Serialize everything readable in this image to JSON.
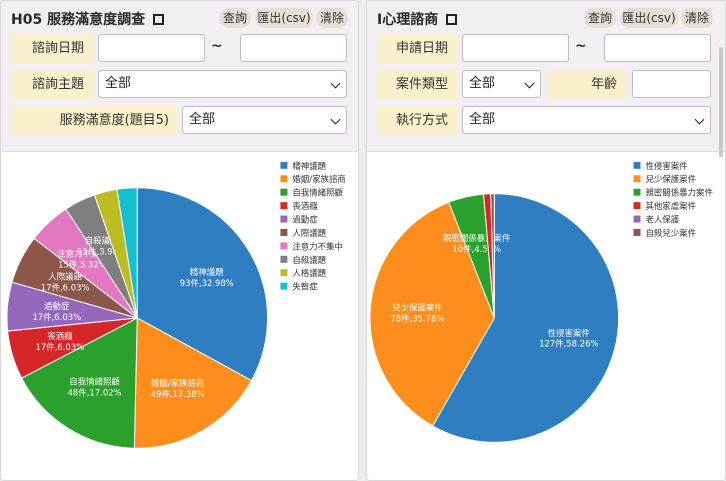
{
  "left_panel": {
    "title": "H05 服務滿意度調查",
    "buttons": {
      "query": "查詢",
      "export": "匯出(csv)",
      "clear": "清除"
    },
    "fields": {
      "date_label": "諮詢日期",
      "date_sep": "~",
      "topic_label": "諮詢主題",
      "topic_value": "全部",
      "satisfaction_label": "服務滿意度(題目5)",
      "satisfaction_value": "全部"
    }
  },
  "right_panel": {
    "title": "I心理諮商",
    "buttons": {
      "query": "查詢",
      "export": "匯出(csv)",
      "clear": "清除"
    },
    "fields": {
      "date_label": "申請日期",
      "date_sep": "~",
      "case_type_label": "案件類型",
      "case_type_value": "全部",
      "age_label": "年齡",
      "method_label": "執行方式",
      "method_value": "全部"
    }
  },
  "chart_data": [
    {
      "type": "pie",
      "legend_position": "top-right",
      "slices": [
        {
          "name": "精神議題",
          "value": 93,
          "label": "93件,32.98%",
          "color": "#2f7ec2"
        },
        {
          "name": "婚姻/家族諮商",
          "value": 49,
          "label": "49件,17.38%",
          "color": "#fd8d1c"
        },
        {
          "name": "自我情緒照顧",
          "value": 48,
          "label": "48件,17.02%",
          "color": "#2ca02c"
        },
        {
          "name": "喪酒癮",
          "value": 17,
          "label": "17件,6.03%",
          "color": "#d62728"
        },
        {
          "name": "過動症",
          "value": 17,
          "label": "17件,6.03%",
          "color": "#9467bd"
        },
        {
          "name": "人際議題",
          "value": 17,
          "label": "17件,6.03%",
          "color": "#8c564b"
        },
        {
          "name": "注意力不集中",
          "value": 15,
          "label": "15件,5.32%",
          "color": "#e377c2"
        },
        {
          "name": "自殺議題",
          "value": 11,
          "label": "11件,3.90%",
          "color": "#7f7f7f"
        },
        {
          "name": "人格議題",
          "value": 8,
          "label": "",
          "color": "#bcbd22"
        },
        {
          "name": "失智症",
          "value": 7,
          "label": "",
          "color": "#17becf"
        }
      ]
    },
    {
      "type": "pie",
      "legend_position": "top-right",
      "slices": [
        {
          "name": "性侵害案件",
          "value": 127,
          "label": "127件,58.26%",
          "color": "#2f7ec2"
        },
        {
          "name": "兒少保護案件",
          "value": 78,
          "label": "78件,35.78%",
          "color": "#fd8d1c"
        },
        {
          "name": "親密關係暴力案件",
          "value": 10,
          "label": "10件,4.59%",
          "color": "#2ca02c"
        },
        {
          "name": "其他家虐案件",
          "value": 2,
          "label": "",
          "color": "#d62728"
        },
        {
          "name": "老人保護",
          "value": 0,
          "label": "",
          "color": "#9467bd"
        },
        {
          "name": "自殺兒少案件",
          "value": 1,
          "label": "",
          "color": "#8c564b"
        }
      ]
    }
  ]
}
